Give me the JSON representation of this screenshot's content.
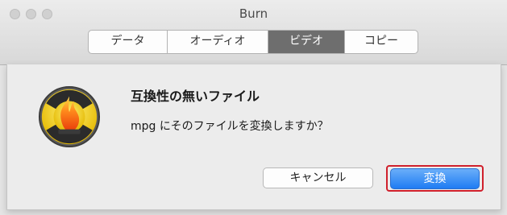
{
  "window": {
    "title": "Burn"
  },
  "tabs": [
    {
      "label": "データ"
    },
    {
      "label": "オーディオ"
    },
    {
      "label": "ビデオ",
      "active": true
    },
    {
      "label": "コピー"
    }
  ],
  "dialog": {
    "icon": "burn-radiation-fire-icon",
    "headline": "互換性の無いファイル",
    "message": "mpg にそのファイルを変換しますか？",
    "cancel_label": "キャンセル",
    "convert_label": "変換"
  },
  "colors": {
    "accent": "#1f7cf3",
    "highlight_ring": "#d0202c",
    "active_tab": "#6e6e6e"
  }
}
